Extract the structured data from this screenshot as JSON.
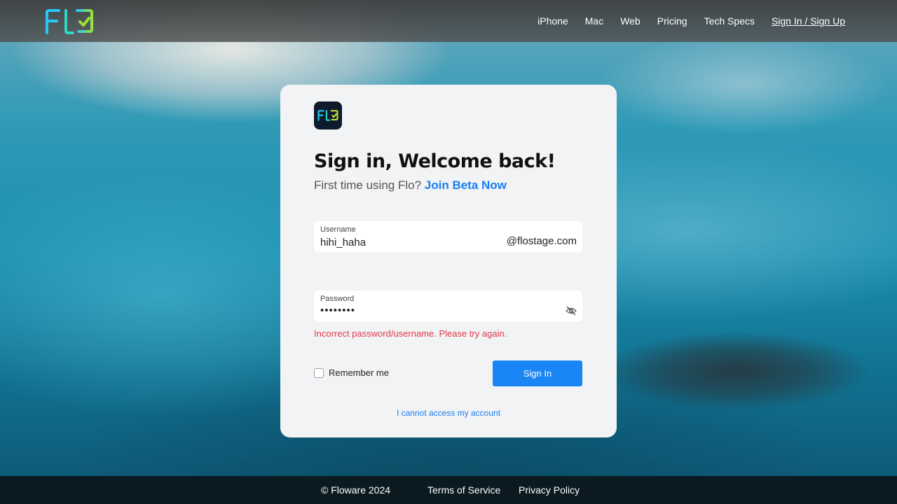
{
  "brand": {
    "logo_text": "Flo",
    "logo_colors": [
      "#27c8f5",
      "#9be23a"
    ]
  },
  "nav": {
    "items": [
      {
        "label": "iPhone"
      },
      {
        "label": "Mac"
      },
      {
        "label": "Web"
      },
      {
        "label": "Pricing"
      },
      {
        "label": "Tech Specs"
      },
      {
        "label": "Sign In / Sign Up"
      }
    ]
  },
  "login": {
    "title": "Sign in, Welcome back!",
    "subtitle_prefix": "First time using Flo?",
    "subtitle_link": "Join Beta Now",
    "username": {
      "label": "Username",
      "value": "hihi_haha",
      "suffix": "@flostage.com"
    },
    "password": {
      "label": "Password",
      "masked_value": "••••••••",
      "toggle_icon": "eye-off-icon"
    },
    "error": "Incorrect password/username. Please try again.",
    "remember_label": "Remember me",
    "remember_checked": false,
    "submit_label": "Sign In",
    "help_link": "I cannot access my account"
  },
  "footer": {
    "copyright": "©  Floware 2024",
    "terms": "Terms of Service",
    "privacy": "Privacy Policy"
  },
  "colors": {
    "accent": "#1a86f5",
    "error": "#e23b4a",
    "card_bg": "#f2f3f5"
  }
}
